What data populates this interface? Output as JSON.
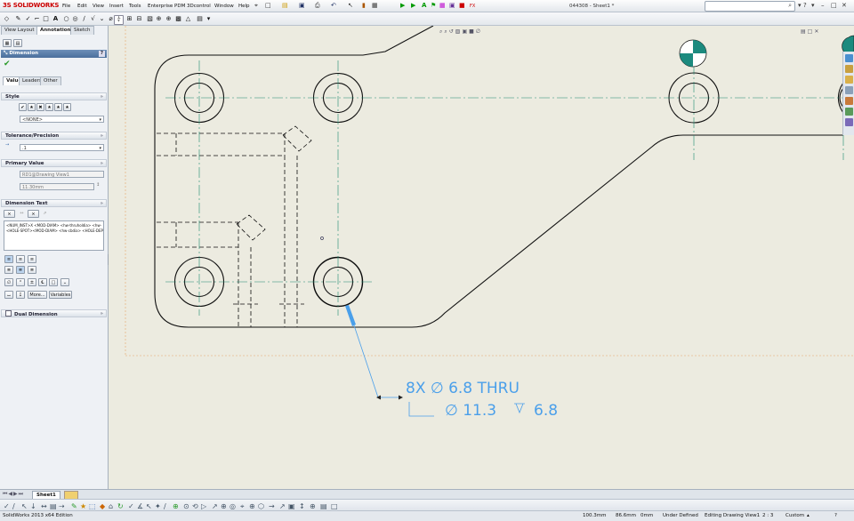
{
  "app": {
    "logo_prefix": "3S",
    "logo": "SOLIDWORKS",
    "menus": [
      "File",
      "Edit",
      "View",
      "Insert",
      "Tools",
      "Enterprise PDM",
      "3Dcontrol",
      "Window",
      "Help"
    ],
    "doc_title": "044308 - Sheet1 *",
    "search_placeholder": "",
    "help_label": "?"
  },
  "left_panel": {
    "tabs": [
      "View Layout",
      "Annotation",
      "Sketch"
    ],
    "active_tab": "Annotation",
    "property_title": "Dimension",
    "help_label": "?",
    "sub_tabs": [
      "Value",
      "Leaders",
      "Other"
    ],
    "style": {
      "header": "Style",
      "select": "<NONE>"
    },
    "tolerance": {
      "header": "Tolerance/Precision",
      "select": ".1"
    },
    "primary_value": {
      "header": "Primary Value",
      "name": "RD1@Drawing View1",
      "value": "11.30mm"
    },
    "dimension_text": {
      "header": "Dimension Text",
      "line1": "<NUM_INST>X <MOD-DIAM> <hw-thruholdia> <hw-",
      "line2": "<HOLE-SPOT><MOD-DIAM> <hw-cbdia> <HOLE-DEP",
      "more_label": "More...",
      "variables_label": "Variables"
    },
    "dual_dimension": {
      "header": "Dual Dimension"
    }
  },
  "drawing": {
    "callout_line1": "8X  ∅ 6.8 THRU",
    "callout_line2_diam": "∅ 11.3",
    "callout_line2_depth": "6.8",
    "accent": "#4a9fea",
    "line_color": "#111111",
    "center_color": "#1c8a6e"
  },
  "sheet": {
    "tab": "Sheet1"
  },
  "status": {
    "edition": "SolidWorks 2013 x64 Edition",
    "x": "100.3mm",
    "y": "86.6mm",
    "z": "0mm",
    "state": "Under Defined",
    "editing": "Editing Drawing View1",
    "scale": "2 : 3",
    "units": "Custom",
    "help": "?"
  }
}
